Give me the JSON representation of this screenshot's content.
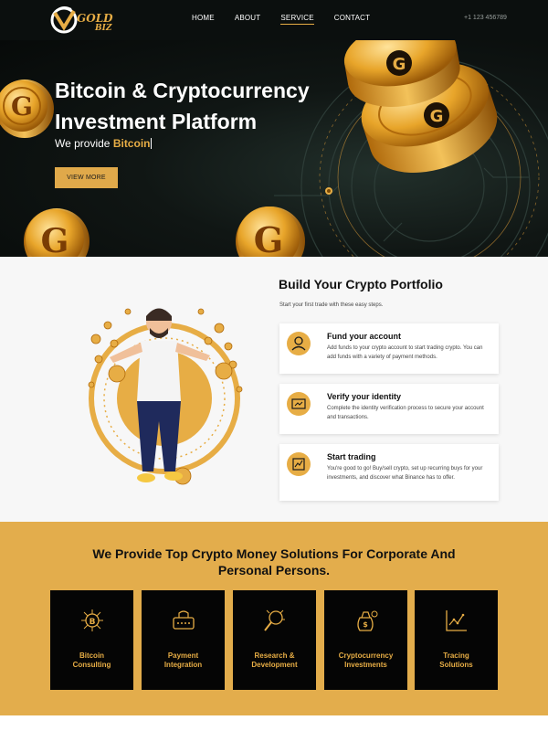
{
  "brand": {
    "name_line1": "GOLD",
    "name_line2": "BIZ",
    "accent": "#e7ad45",
    "dark": "#0b0f0e"
  },
  "nav": {
    "items": [
      {
        "label": "HOME"
      },
      {
        "label": "ABOUT"
      },
      {
        "label": "SERVICE"
      },
      {
        "label": "CONTACT"
      }
    ],
    "phone": "+1 123 456789"
  },
  "hero": {
    "title_line1": "Bitcoin & Cryptocurrency",
    "title_line2": "Investment Platform",
    "sub_prefix": "We provide ",
    "sub_highlight": "Bitcoin",
    "button": "VIEW MORE"
  },
  "portfolio": {
    "title": "Build Your Crypto Portfolio",
    "subtitle": "Start your first trade with these easy steps.",
    "steps": [
      {
        "title": "Fund your account",
        "desc": "Add funds to your crypto account to start trading crypto. You can add funds with a variety of payment methods.",
        "icon": "wallet-user-icon"
      },
      {
        "title": "Verify your identity",
        "desc": "Complete the identity verification process to secure your account and transactions.",
        "icon": "id-card-icon"
      },
      {
        "title": "Start trading",
        "desc": "You're good to go! Buy/sell crypto, set up recurring buys for your investments, and discover what Binance has to offer.",
        "icon": "trade-chart-icon"
      }
    ]
  },
  "services": {
    "title_line1": "We Provide Top Crypto Money Solutions For Corporate And",
    "title_line2": "Personal Persons.",
    "cards": [
      {
        "line1": "Bitcoin",
        "line2": "Consulting",
        "icon": "bitcoin-network-icon"
      },
      {
        "line1": "Payment",
        "line2": "Integration",
        "icon": "payment-card-icon"
      },
      {
        "line1": "Research &",
        "line2": "Development",
        "icon": "research-magnifier-icon"
      },
      {
        "line1": "Cryptocurrency",
        "line2": "Investments",
        "icon": "money-bag-icon"
      },
      {
        "line1": "Tracing",
        "line2": "Solutions",
        "icon": "tracing-chart-icon"
      }
    ]
  }
}
